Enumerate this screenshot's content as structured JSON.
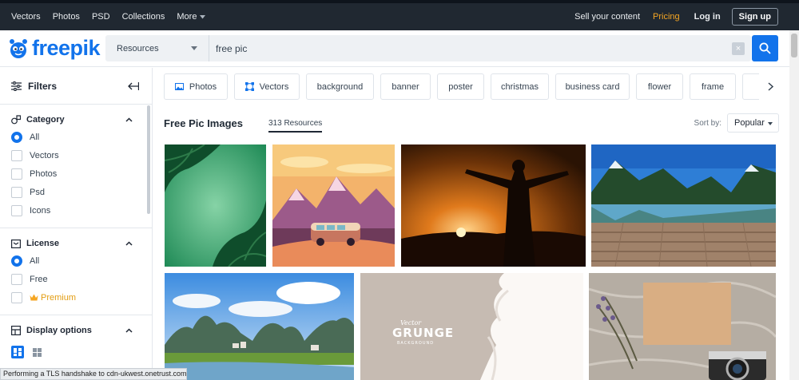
{
  "topnav": {
    "links": [
      "Vectors",
      "Photos",
      "PSD",
      "Collections"
    ],
    "more_label": "More",
    "sell_label": "Sell your content",
    "pricing_label": "Pricing",
    "login_label": "Log in",
    "signup_label": "Sign up"
  },
  "header": {
    "logo_text": "freepik",
    "resources_label": "Resources",
    "search_query": "free pic",
    "clear_glyph": "×"
  },
  "sidebar": {
    "filters_label": "Filters",
    "category": {
      "title": "Category",
      "options": [
        "All",
        "Vectors",
        "Photos",
        "Psd",
        "Icons"
      ]
    },
    "license": {
      "title": "License",
      "options": [
        "All",
        "Free",
        "Premium"
      ]
    },
    "display": {
      "title": "Display options"
    }
  },
  "tags": [
    "Photos",
    "Vectors",
    "background",
    "banner",
    "poster",
    "christmas",
    "business card",
    "flower",
    "frame"
  ],
  "results": {
    "title": "Free Pic Images",
    "count": "313 Resources",
    "sort_label": "Sort by:",
    "sort_value": "Popular"
  },
  "images": [
    {
      "subject": "tropical leaves green frame"
    },
    {
      "subject": "retro van mountain sunset illustration"
    },
    {
      "subject": "man silhouette sunset arms raised"
    },
    {
      "subject": "mountain lake wooden pier"
    },
    {
      "subject": "karst mountains river village"
    },
    {
      "subject": "vector grunge background",
      "text_top": "Vector",
      "text_main": "GRUNGE",
      "text_sub": "BACKGROUND"
    },
    {
      "subject": "lavender envelope camera flat lay"
    }
  ],
  "status": {
    "text": "Performing a TLS handshake to cdn-ukwest.onetrust.com..."
  },
  "colors": {
    "brand_blue": "#1273eb",
    "topbar": "#202831",
    "pricing": "#f5a623",
    "premium": "#e39d12"
  }
}
